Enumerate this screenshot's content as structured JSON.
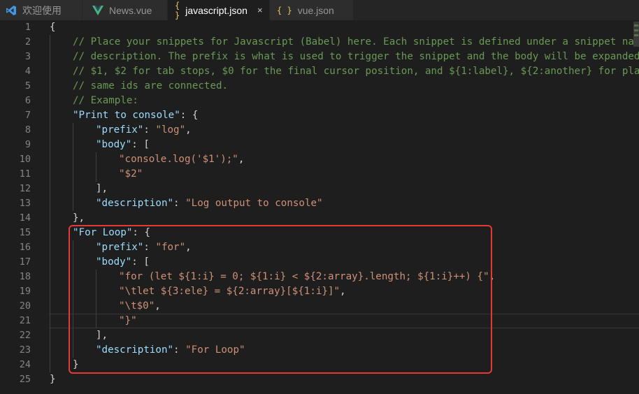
{
  "tabs": [
    {
      "label": "欢迎使用",
      "icon": "vscode-logo-icon",
      "active": false
    },
    {
      "label": "News.vue",
      "icon": "vue-logo-icon",
      "active": false
    },
    {
      "label": "javascript.json",
      "icon": "json-braces-icon",
      "active": true,
      "close": "×"
    },
    {
      "label": "vue.json",
      "icon": "json-braces-icon",
      "active": false
    }
  ],
  "icons": {
    "braces": "{ }"
  },
  "colors": {
    "editor_bg": "#1e1e1e",
    "key": "#9cdcfe",
    "string": "#ce9178",
    "comment": "#6a9955",
    "highlight_box": "#e53935"
  },
  "editor": {
    "current_line": 21,
    "lines": [
      {
        "n": "1",
        "indent": 0,
        "tokens": [
          {
            "t": "p",
            "v": "{"
          }
        ]
      },
      {
        "n": "2",
        "indent": 1,
        "tokens": [
          {
            "t": "c",
            "v": "// Place your snippets for Javascript (Babel) here. Each snippet is defined under a snippet nam"
          }
        ]
      },
      {
        "n": "3",
        "indent": 1,
        "tokens": [
          {
            "t": "c",
            "v": "// description. The prefix is what is used to trigger the snippet and the body will be expanded"
          }
        ]
      },
      {
        "n": "4",
        "indent": 1,
        "tokens": [
          {
            "t": "c",
            "v": "// $1, $2 for tab stops, $0 for the final cursor position, and ${1:label}, ${2:another} for pla"
          }
        ]
      },
      {
        "n": "5",
        "indent": 1,
        "tokens": [
          {
            "t": "c",
            "v": "// same ids are connected."
          }
        ]
      },
      {
        "n": "6",
        "indent": 1,
        "tokens": [
          {
            "t": "c",
            "v": "// Example:"
          }
        ]
      },
      {
        "n": "7",
        "indent": 1,
        "tokens": [
          {
            "t": "k",
            "v": "\"Print to console\""
          },
          {
            "t": "p",
            "v": ": {"
          }
        ]
      },
      {
        "n": "8",
        "indent": 2,
        "tokens": [
          {
            "t": "k",
            "v": "\"prefix\""
          },
          {
            "t": "p",
            "v": ": "
          },
          {
            "t": "s",
            "v": "\"log\""
          },
          {
            "t": "p",
            "v": ","
          }
        ]
      },
      {
        "n": "9",
        "indent": 2,
        "tokens": [
          {
            "t": "k",
            "v": "\"body\""
          },
          {
            "t": "p",
            "v": ": ["
          }
        ]
      },
      {
        "n": "10",
        "indent": 3,
        "tokens": [
          {
            "t": "s",
            "v": "\"console.log('$1');\""
          },
          {
            "t": "p",
            "v": ","
          }
        ]
      },
      {
        "n": "11",
        "indent": 3,
        "tokens": [
          {
            "t": "s",
            "v": "\"$2\""
          }
        ]
      },
      {
        "n": "12",
        "indent": 2,
        "tokens": [
          {
            "t": "p",
            "v": "],"
          }
        ]
      },
      {
        "n": "13",
        "indent": 2,
        "tokens": [
          {
            "t": "k",
            "v": "\"description\""
          },
          {
            "t": "p",
            "v": ": "
          },
          {
            "t": "s",
            "v": "\"Log output to console\""
          }
        ]
      },
      {
        "n": "14",
        "indent": 1,
        "tokens": [
          {
            "t": "p",
            "v": "},"
          }
        ]
      },
      {
        "n": "15",
        "indent": 1,
        "tokens": [
          {
            "t": "k",
            "v": "\"For Loop\""
          },
          {
            "t": "p",
            "v": ": {"
          }
        ]
      },
      {
        "n": "16",
        "indent": 2,
        "tokens": [
          {
            "t": "k",
            "v": "\"prefix\""
          },
          {
            "t": "p",
            "v": ": "
          },
          {
            "t": "s",
            "v": "\"for\""
          },
          {
            "t": "p",
            "v": ","
          }
        ]
      },
      {
        "n": "17",
        "indent": 2,
        "tokens": [
          {
            "t": "k",
            "v": "\"body\""
          },
          {
            "t": "p",
            "v": ": ["
          }
        ]
      },
      {
        "n": "18",
        "indent": 3,
        "tokens": [
          {
            "t": "s",
            "v": "\"for (let ${1:i} = 0; ${1:i} < ${2:array}.length; ${1:i}++) {\""
          },
          {
            "t": "p",
            "v": ","
          }
        ]
      },
      {
        "n": "19",
        "indent": 3,
        "tokens": [
          {
            "t": "s",
            "v": "\"\\tlet ${3:ele} = ${2:array}[${1:i}]\""
          },
          {
            "t": "p",
            "v": ","
          }
        ]
      },
      {
        "n": "20",
        "indent": 3,
        "tokens": [
          {
            "t": "s",
            "v": "\"\\t$0\""
          },
          {
            "t": "p",
            "v": ","
          }
        ]
      },
      {
        "n": "21",
        "indent": 3,
        "tokens": [
          {
            "t": "s",
            "v": "\"}\""
          }
        ]
      },
      {
        "n": "22",
        "indent": 2,
        "tokens": [
          {
            "t": "p",
            "v": "],"
          }
        ]
      },
      {
        "n": "23",
        "indent": 2,
        "tokens": [
          {
            "t": "k",
            "v": "\"description\""
          },
          {
            "t": "p",
            "v": ": "
          },
          {
            "t": "s",
            "v": "\"For Loop\""
          }
        ]
      },
      {
        "n": "24",
        "indent": 1,
        "tokens": [
          {
            "t": "p",
            "v": "}"
          }
        ]
      },
      {
        "n": "25",
        "indent": 0,
        "tokens": [
          {
            "t": "p",
            "v": "}"
          }
        ]
      }
    ]
  }
}
